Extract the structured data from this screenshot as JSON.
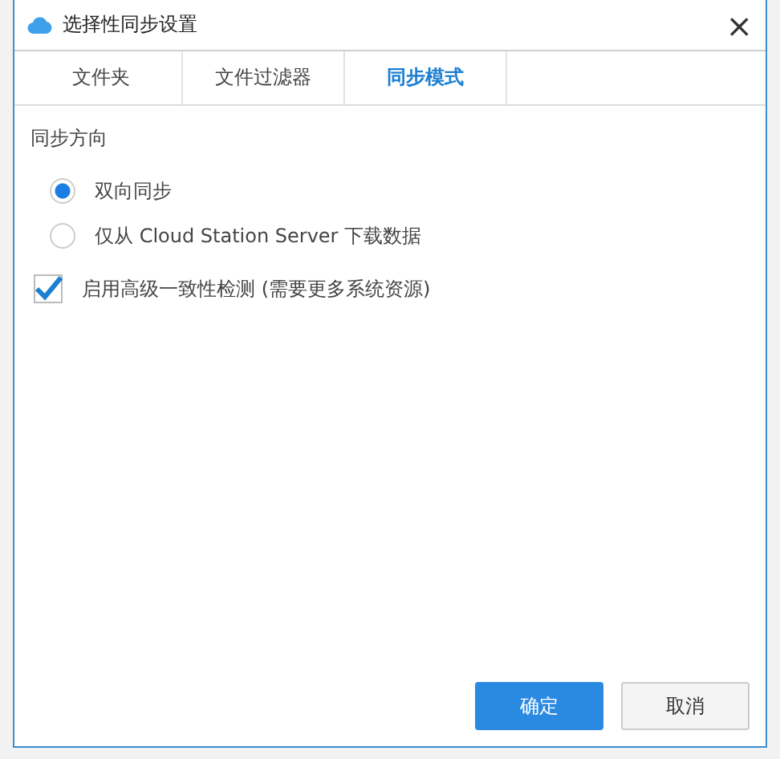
{
  "window": {
    "title": "选择性同步设置",
    "close": "×"
  },
  "tabs": [
    {
      "label": "文件夹",
      "selected": false
    },
    {
      "label": "文件过滤器",
      "selected": false
    },
    {
      "label": "同步模式",
      "selected": true
    }
  ],
  "section_title": "同步方向",
  "options": [
    {
      "label": "双向同步",
      "selected": true
    },
    {
      "label": "仅从 Cloud Station Server 下载数据",
      "selected": false
    }
  ],
  "checkbox": {
    "label": "启用高级一致性检测 (需要更多系统资源)",
    "checked": true
  },
  "buttons": [
    {
      "label": "确定",
      "kind": "primary"
    },
    {
      "label": "取消",
      "kind": "secondary"
    }
  ]
}
